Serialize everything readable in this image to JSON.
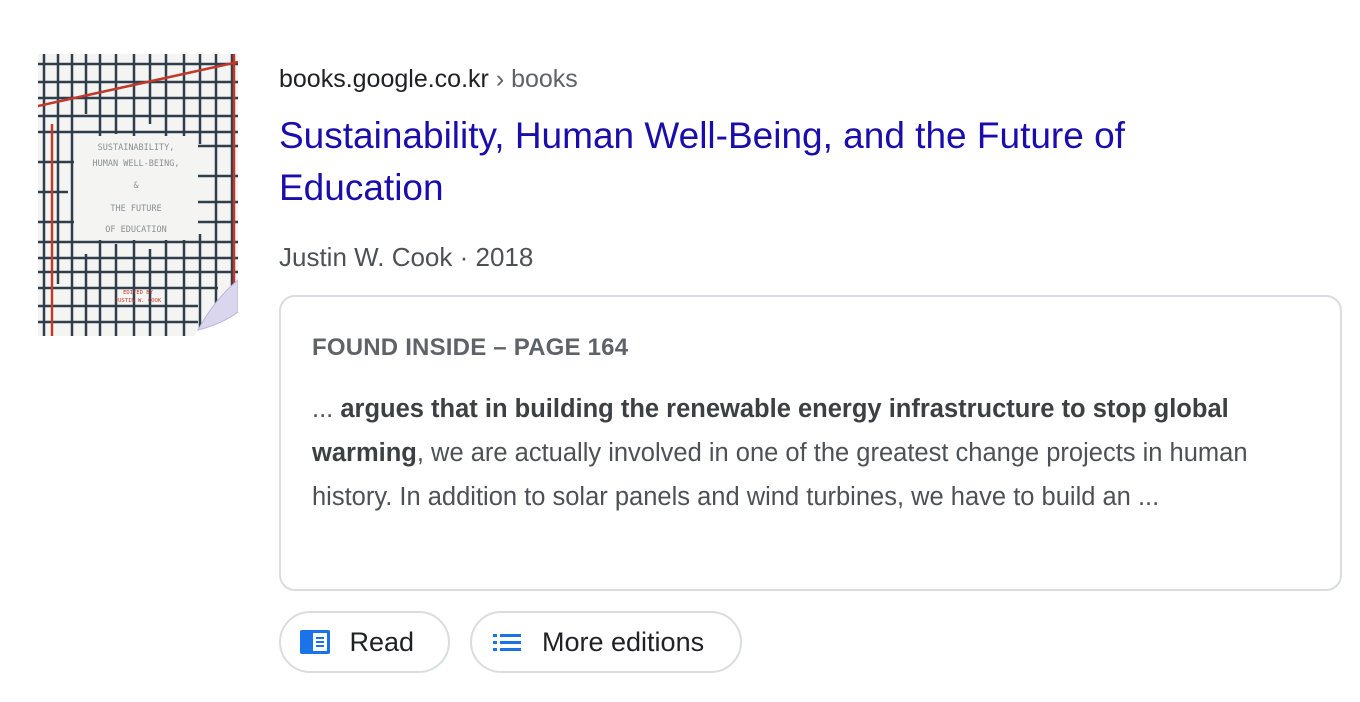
{
  "result": {
    "breadcrumb": {
      "domain": "books.google.co.kr",
      "separator": "›",
      "path": "books"
    },
    "title": "Sustainability, Human Well-Being, and the Future of Education",
    "meta": "Justin W. Cook · 2018",
    "cover": {
      "lines": [
        "SUSTAINABILITY,",
        "HUMAN WELL-BEING,",
        "&",
        "THE FUTURE",
        "OF EDUCATION"
      ],
      "editor": "EDITED BY",
      "editor_name": "JUSTIN W. COOK"
    },
    "snippet": {
      "heading": "FOUND INSIDE – PAGE 164",
      "lead": "... ",
      "bold": "argues that in building the renewable energy infrastructure to stop global warming",
      "rest": ", we are actually involved in one of the greatest change projects in human history. In addition to solar panels and wind turbines, we have to build an ..."
    },
    "actions": {
      "read_label": "Read",
      "editions_label": "More editions"
    }
  },
  "colors": {
    "link": "#1a0dab",
    "text": "#202124",
    "muted": "#4d5156",
    "border": "#dadce0",
    "icon_blue": "#1a73e8",
    "cover_red": "#c0392b",
    "cover_grid": "#2f3e4a"
  },
  "icons": {
    "read": "book-open-icon",
    "editions": "list-icon"
  }
}
